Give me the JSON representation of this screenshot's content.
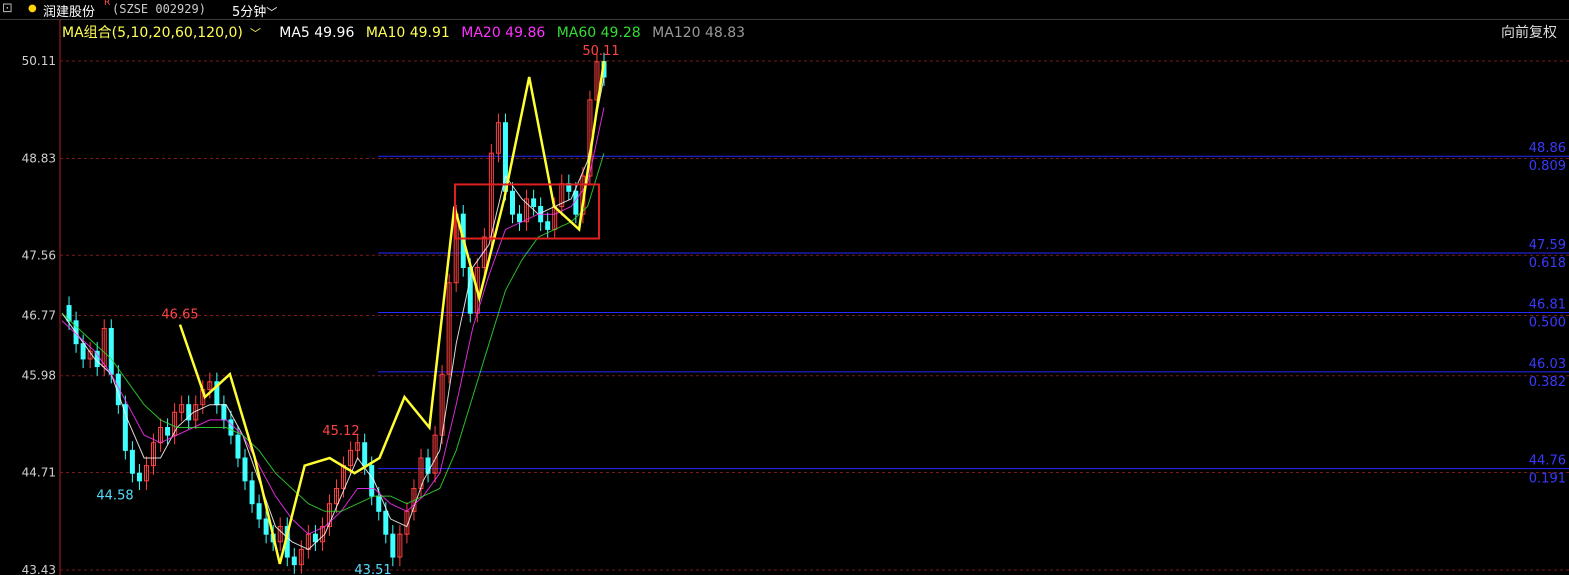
{
  "header": {
    "stock_name": "润建股份",
    "superscript": "R",
    "code": "(SZSE 002929)",
    "period": "5分钟",
    "adjust": "向前复权"
  },
  "ma_bar": {
    "group": "MA组合(5,10,20,60,120,0)",
    "items": [
      {
        "label": "MA5 49.96",
        "color": "#ffffff"
      },
      {
        "label": "MA10 49.91",
        "color": "#ffff55"
      },
      {
        "label": "MA20 49.86",
        "color": "#ff33ff"
      },
      {
        "label": "MA60 49.28",
        "color": "#33dd33"
      },
      {
        "label": "MA120 48.83",
        "color": "#999999"
      }
    ]
  },
  "chart_data": {
    "type": "line",
    "yticks": [
      "50.11",
      "48.83",
      "47.56",
      "46.77",
      "45.98",
      "44.71",
      "43.43"
    ],
    "ylim": [
      43.43,
      50.11
    ],
    "annotations": [
      {
        "text": "50.11",
        "price": 50.11,
        "color": "#ff4444"
      },
      {
        "text": "46.65",
        "price": 46.65,
        "color": "#ff4444"
      },
      {
        "text": "45.12",
        "price": 45.12,
        "color": "#ff4444"
      },
      {
        "text": "44.58",
        "price": 44.58,
        "color": "#55ddff"
      },
      {
        "text": "43.51",
        "price": 43.51,
        "color": "#55ddff"
      }
    ],
    "fib_levels": [
      {
        "price": "48.86",
        "ratio": "0.809"
      },
      {
        "price": "47.59",
        "ratio": "0.618"
      },
      {
        "price": "46.81",
        "ratio": "0.500"
      },
      {
        "price": "46.03",
        "ratio": "0.382"
      },
      {
        "price": "44.76",
        "ratio": "0.191"
      }
    ],
    "price_series": [
      46.9,
      46.7,
      46.4,
      46.2,
      46.3,
      46.1,
      46.6,
      46.0,
      45.6,
      45.0,
      44.7,
      44.6,
      44.8,
      45.1,
      45.3,
      45.2,
      45.5,
      45.6,
      45.4,
      45.6,
      45.8,
      45.9,
      45.6,
      45.4,
      45.2,
      44.9,
      44.6,
      44.3,
      44.1,
      43.9,
      43.8,
      44.0,
      43.6,
      43.5,
      43.7,
      43.9,
      43.8,
      44.0,
      44.3,
      44.5,
      44.8,
      45.0,
      45.1,
      44.8,
      44.4,
      44.2,
      43.9,
      43.6,
      43.9,
      44.2,
      44.5,
      44.9,
      44.7,
      45.2,
      46.0,
      47.2,
      48.1,
      47.4,
      46.8,
      47.4,
      47.8,
      48.9,
      49.3,
      48.4,
      48.1,
      48.0,
      48.3,
      48.2,
      48.0,
      47.9,
      48.2,
      48.5,
      48.4,
      48.1,
      48.6,
      49.6,
      50.1,
      49.9
    ],
    "zigzag": [
      46.65,
      45.7,
      46.0,
      44.9,
      43.51,
      44.8,
      44.9,
      44.7,
      44.9,
      45.7,
      45.3,
      48.2,
      47.0,
      48.3,
      49.9,
      48.2,
      47.9,
      50.11
    ],
    "ma_series": [
      {
        "name": "MA5",
        "color": "#ffffff",
        "values": [
          46.8,
          46.5,
          46.2,
          46.0,
          45.4,
          44.9,
          44.9,
          45.3,
          45.5,
          45.6,
          45.6,
          45.2,
          44.6,
          44.0,
          43.8,
          43.7,
          43.9,
          44.4,
          44.9,
          44.6,
          44.1,
          44.0,
          44.6,
          45.0,
          46.4,
          47.4,
          47.7,
          48.6,
          48.3,
          48.1,
          48.2,
          48.3,
          48.8,
          49.9
        ]
      },
      {
        "name": "MA20",
        "color": "#ff33ff",
        "values": [
          46.7,
          46.5,
          46.3,
          46.0,
          45.6,
          45.2,
          45.1,
          45.2,
          45.3,
          45.4,
          45.4,
          45.2,
          44.8,
          44.4,
          44.1,
          43.9,
          44.0,
          44.2,
          44.5,
          44.5,
          44.3,
          44.2,
          44.4,
          44.7,
          45.6,
          46.6,
          47.3,
          47.9,
          48.0,
          48.1,
          48.1,
          48.2,
          48.5,
          49.5
        ]
      },
      {
        "name": "MA60",
        "color": "#33dd33",
        "values": [
          46.8,
          46.6,
          46.4,
          46.2,
          45.9,
          45.6,
          45.4,
          45.3,
          45.3,
          45.3,
          45.3,
          45.2,
          45.0,
          44.7,
          44.5,
          44.3,
          44.2,
          44.2,
          44.3,
          44.4,
          44.4,
          44.3,
          44.4,
          44.5,
          45.0,
          45.7,
          46.4,
          47.1,
          47.5,
          47.8,
          47.9,
          48.0,
          48.2,
          48.9
        ]
      }
    ]
  }
}
